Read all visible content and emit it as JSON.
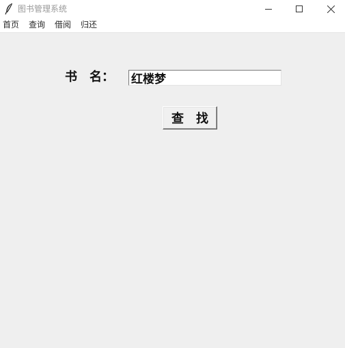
{
  "window": {
    "title": "图书管理系统",
    "controls": {
      "minimize_icon": "minimize-icon",
      "maximize_icon": "maximize-icon",
      "close_icon": "close-icon"
    }
  },
  "menu": {
    "items": [
      {
        "label": "首页"
      },
      {
        "label": "查询"
      },
      {
        "label": "借阅"
      },
      {
        "label": "归还"
      }
    ]
  },
  "form": {
    "book_name_label": "书　名：",
    "book_name_value": "红楼梦",
    "search_button_label": "查　找"
  },
  "colors": {
    "background": "#efefef",
    "titlebar": "#ffffff",
    "title_text": "#9a9a9a"
  }
}
